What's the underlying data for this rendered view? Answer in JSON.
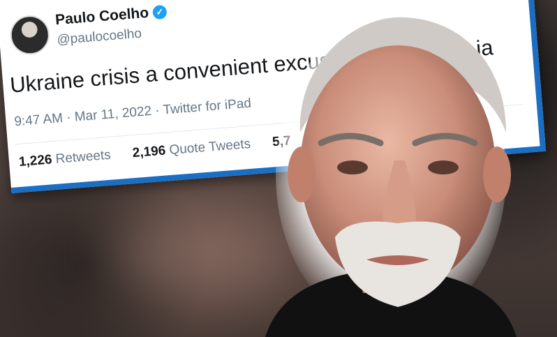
{
  "tweet": {
    "name": "Paulo Coelho",
    "handle": "@paulocoelho",
    "text": "Ukraine crisis a convenient excus",
    "text_cut": "ia",
    "time": "9:47 AM · Mar 11, 2022 · Twitter for iPad",
    "stats": [
      {
        "count": "1,226",
        "label": "Retweets"
      },
      {
        "count": "2,196",
        "label": "Quote Tweets"
      },
      {
        "count": "5,7",
        "label": ""
      }
    ]
  },
  "icons": {
    "verified": "verified-badge-icon",
    "avatar": "profile-avatar"
  },
  "colors": {
    "accent": "#1b6ec2",
    "verified": "#1da1f2"
  }
}
